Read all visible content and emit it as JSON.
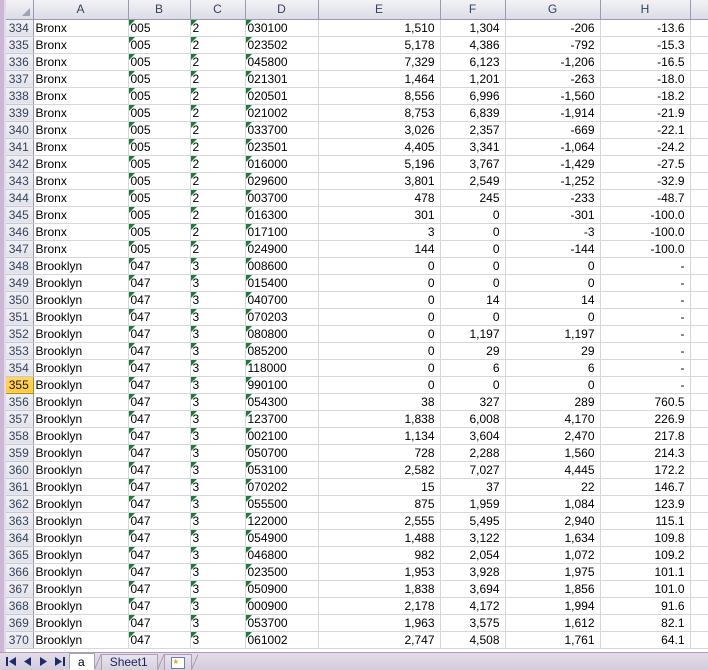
{
  "app": {
    "type": "spreadsheet",
    "accent_active_row": "#ffca3d",
    "header_bg": "#e6e6ee",
    "gridline_color": "#d6d6de",
    "error_triangle_color": "#1f7a34"
  },
  "grid": {
    "corner_label": "",
    "columns": [
      "A",
      "B",
      "C",
      "D",
      "E",
      "F",
      "G",
      "H"
    ],
    "active_row": "355",
    "rows": [
      {
        "n": "334",
        "a": "Bronx",
        "b": "005",
        "c": "2",
        "d": "030100",
        "e": "1,510",
        "f": "1,304",
        "g": "-206",
        "h": "-13.6"
      },
      {
        "n": "335",
        "a": "Bronx",
        "b": "005",
        "c": "2",
        "d": "023502",
        "e": "5,178",
        "f": "4,386",
        "g": "-792",
        "h": "-15.3"
      },
      {
        "n": "336",
        "a": "Bronx",
        "b": "005",
        "c": "2",
        "d": "045800",
        "e": "7,329",
        "f": "6,123",
        "g": "-1,206",
        "h": "-16.5"
      },
      {
        "n": "337",
        "a": "Bronx",
        "b": "005",
        "c": "2",
        "d": "021301",
        "e": "1,464",
        "f": "1,201",
        "g": "-263",
        "h": "-18.0"
      },
      {
        "n": "338",
        "a": "Bronx",
        "b": "005",
        "c": "2",
        "d": "020501",
        "e": "8,556",
        "f": "6,996",
        "g": "-1,560",
        "h": "-18.2"
      },
      {
        "n": "339",
        "a": "Bronx",
        "b": "005",
        "c": "2",
        "d": "021002",
        "e": "8,753",
        "f": "6,839",
        "g": "-1,914",
        "h": "-21.9"
      },
      {
        "n": "340",
        "a": "Bronx",
        "b": "005",
        "c": "2",
        "d": "033700",
        "e": "3,026",
        "f": "2,357",
        "g": "-669",
        "h": "-22.1"
      },
      {
        "n": "341",
        "a": "Bronx",
        "b": "005",
        "c": "2",
        "d": "023501",
        "e": "4,405",
        "f": "3,341",
        "g": "-1,064",
        "h": "-24.2"
      },
      {
        "n": "342",
        "a": "Bronx",
        "b": "005",
        "c": "2",
        "d": "016000",
        "e": "5,196",
        "f": "3,767",
        "g": "-1,429",
        "h": "-27.5"
      },
      {
        "n": "343",
        "a": "Bronx",
        "b": "005",
        "c": "2",
        "d": "029600",
        "e": "3,801",
        "f": "2,549",
        "g": "-1,252",
        "h": "-32.9"
      },
      {
        "n": "344",
        "a": "Bronx",
        "b": "005",
        "c": "2",
        "d": "003700",
        "e": "478",
        "f": "245",
        "g": "-233",
        "h": "-48.7"
      },
      {
        "n": "345",
        "a": "Bronx",
        "b": "005",
        "c": "2",
        "d": "016300",
        "e": "301",
        "f": "0",
        "g": "-301",
        "h": "-100.0"
      },
      {
        "n": "346",
        "a": "Bronx",
        "b": "005",
        "c": "2",
        "d": "017100",
        "e": "3",
        "f": "0",
        "g": "-3",
        "h": "-100.0"
      },
      {
        "n": "347",
        "a": "Bronx",
        "b": "005",
        "c": "2",
        "d": "024900",
        "e": "144",
        "f": "0",
        "g": "-144",
        "h": "-100.0"
      },
      {
        "n": "348",
        "a": "Brooklyn",
        "b": "047",
        "c": "3",
        "d": "008600",
        "e": "0",
        "f": "0",
        "g": "0",
        "h": "-"
      },
      {
        "n": "349",
        "a": "Brooklyn",
        "b": "047",
        "c": "3",
        "d": "015400",
        "e": "0",
        "f": "0",
        "g": "0",
        "h": "-"
      },
      {
        "n": "350",
        "a": "Brooklyn",
        "b": "047",
        "c": "3",
        "d": "040700",
        "e": "0",
        "f": "14",
        "g": "14",
        "h": "-"
      },
      {
        "n": "351",
        "a": "Brooklyn",
        "b": "047",
        "c": "3",
        "d": "070203",
        "e": "0",
        "f": "0",
        "g": "0",
        "h": "-"
      },
      {
        "n": "352",
        "a": "Brooklyn",
        "b": "047",
        "c": "3",
        "d": "080800",
        "e": "0",
        "f": "1,197",
        "g": "1,197",
        "h": "-"
      },
      {
        "n": "353",
        "a": "Brooklyn",
        "b": "047",
        "c": "3",
        "d": "085200",
        "e": "0",
        "f": "29",
        "g": "29",
        "h": "-"
      },
      {
        "n": "354",
        "a": "Brooklyn",
        "b": "047",
        "c": "3",
        "d": "118000",
        "e": "0",
        "f": "6",
        "g": "6",
        "h": "-"
      },
      {
        "n": "355",
        "a": "Brooklyn",
        "b": "047",
        "c": "3",
        "d": "990100",
        "e": "0",
        "f": "0",
        "g": "0",
        "h": "-"
      },
      {
        "n": "356",
        "a": "Brooklyn",
        "b": "047",
        "c": "3",
        "d": "054300",
        "e": "38",
        "f": "327",
        "g": "289",
        "h": "760.5"
      },
      {
        "n": "357",
        "a": "Brooklyn",
        "b": "047",
        "c": "3",
        "d": "123700",
        "e": "1,838",
        "f": "6,008",
        "g": "4,170",
        "h": "226.9"
      },
      {
        "n": "358",
        "a": "Brooklyn",
        "b": "047",
        "c": "3",
        "d": "002100",
        "e": "1,134",
        "f": "3,604",
        "g": "2,470",
        "h": "217.8"
      },
      {
        "n": "359",
        "a": "Brooklyn",
        "b": "047",
        "c": "3",
        "d": "050700",
        "e": "728",
        "f": "2,288",
        "g": "1,560",
        "h": "214.3"
      },
      {
        "n": "360",
        "a": "Brooklyn",
        "b": "047",
        "c": "3",
        "d": "053100",
        "e": "2,582",
        "f": "7,027",
        "g": "4,445",
        "h": "172.2"
      },
      {
        "n": "361",
        "a": "Brooklyn",
        "b": "047",
        "c": "3",
        "d": "070202",
        "e": "15",
        "f": "37",
        "g": "22",
        "h": "146.7"
      },
      {
        "n": "362",
        "a": "Brooklyn",
        "b": "047",
        "c": "3",
        "d": "055500",
        "e": "875",
        "f": "1,959",
        "g": "1,084",
        "h": "123.9"
      },
      {
        "n": "363",
        "a": "Brooklyn",
        "b": "047",
        "c": "3",
        "d": "122000",
        "e": "2,555",
        "f": "5,495",
        "g": "2,940",
        "h": "115.1"
      },
      {
        "n": "364",
        "a": "Brooklyn",
        "b": "047",
        "c": "3",
        "d": "054900",
        "e": "1,488",
        "f": "3,122",
        "g": "1,634",
        "h": "109.8"
      },
      {
        "n": "365",
        "a": "Brooklyn",
        "b": "047",
        "c": "3",
        "d": "046800",
        "e": "982",
        "f": "2,054",
        "g": "1,072",
        "h": "109.2"
      },
      {
        "n": "366",
        "a": "Brooklyn",
        "b": "047",
        "c": "3",
        "d": "023500",
        "e": "1,953",
        "f": "3,928",
        "g": "1,975",
        "h": "101.1"
      },
      {
        "n": "367",
        "a": "Brooklyn",
        "b": "047",
        "c": "3",
        "d": "050900",
        "e": "1,838",
        "f": "3,694",
        "g": "1,856",
        "h": "101.0"
      },
      {
        "n": "368",
        "a": "Brooklyn",
        "b": "047",
        "c": "3",
        "d": "000900",
        "e": "2,178",
        "f": "4,172",
        "g": "1,994",
        "h": "91.6"
      },
      {
        "n": "369",
        "a": "Brooklyn",
        "b": "047",
        "c": "3",
        "d": "053700",
        "e": "1,963",
        "f": "3,575",
        "g": "1,612",
        "h": "82.1"
      },
      {
        "n": "370",
        "a": "Brooklyn",
        "b": "047",
        "c": "3",
        "d": "061002",
        "e": "2,747",
        "f": "4,508",
        "g": "1,761",
        "h": "64.1"
      }
    ]
  },
  "tabbar": {
    "nav": [
      {
        "name": "first-sheet",
        "glyph": "first"
      },
      {
        "name": "prev-sheet",
        "glyph": "prev"
      },
      {
        "name": "next-sheet",
        "glyph": "next"
      },
      {
        "name": "last-sheet",
        "glyph": "last"
      }
    ],
    "tabs": [
      {
        "label": "a",
        "active": true
      },
      {
        "label": "Sheet1",
        "active": false
      }
    ],
    "insert_tab_label": ""
  }
}
